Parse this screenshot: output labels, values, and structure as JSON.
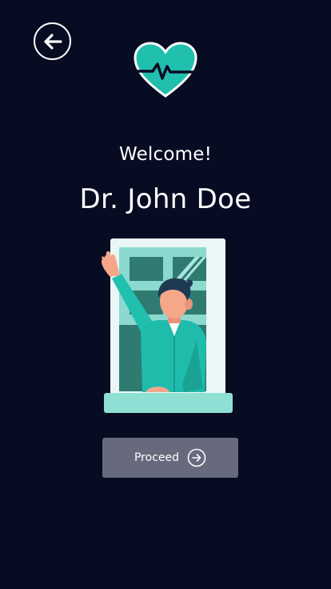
{
  "header": {
    "back_icon": "arrow-left-circle-icon",
    "logo_icon": "heart-pulse-icon"
  },
  "welcome": {
    "greeting": "Welcome!",
    "name": "Dr. John Doe"
  },
  "illustration": {
    "icon": "doctor-waving-window-illustration"
  },
  "actions": {
    "proceed_label": "Proceed",
    "proceed_icon": "arrow-right-circle-icon"
  },
  "colors": {
    "background": "#080c22",
    "accent": "#21bfae",
    "button": "#676a7c",
    "text": "#ffffff"
  }
}
